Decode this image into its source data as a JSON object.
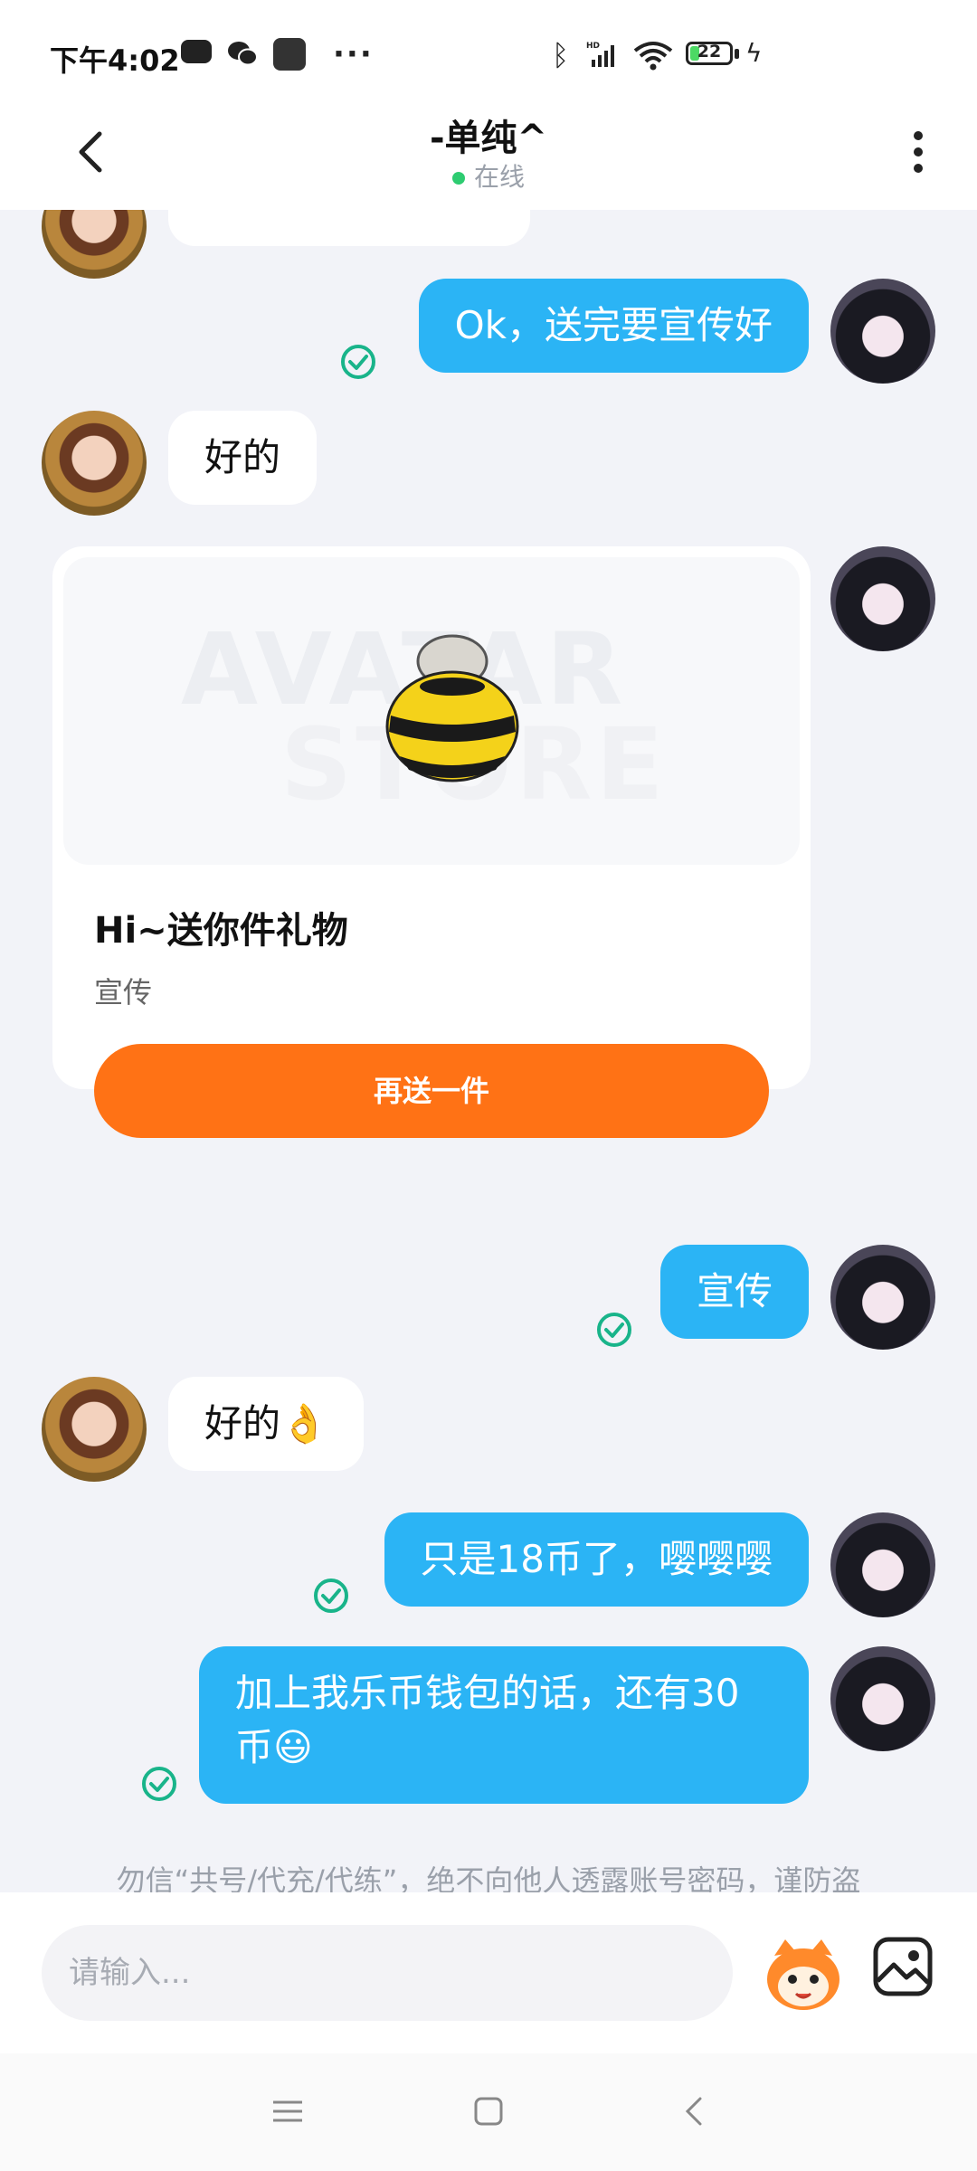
{
  "status_bar": {
    "time": "下午4:02",
    "battery_level": "22",
    "icons": [
      "game-icon",
      "wechat-icon",
      "app-icon",
      "more-dots-icon",
      "bluetooth-icon",
      "signal-icon",
      "wifi-icon",
      "battery-icon",
      "charging-icon"
    ]
  },
  "header": {
    "title": "-单纯^",
    "status": "在线",
    "status_color": "#2ecc71"
  },
  "messages": [
    {
      "from": "me",
      "text": "Ok，送完要宣传好",
      "read": true
    },
    {
      "from": "her",
      "text": "好的"
    },
    {
      "from": "her",
      "type": "gift_card",
      "title": "Hi~送你件礼物",
      "subtitle": "宣传",
      "button": "再送一件"
    },
    {
      "from": "me",
      "text": "宣传",
      "read": true
    },
    {
      "from": "her",
      "text": "好的👌"
    },
    {
      "from": "me",
      "text": "只是18币了，嘤嘤嘤",
      "read": true
    },
    {
      "from": "me",
      "text": "加上我乐币钱包的话，还有30币😃",
      "read": true
    }
  ],
  "gift_card": {
    "image_watermark_line1": "AVATAR",
    "image_watermark_line2": "STORE",
    "title": "Hi~送你件礼物",
    "subtitle": "宣传",
    "button_label": "再送一件"
  },
  "notice": "勿信“共号/代充/代练”，绝不向他人透露账号密码，谨防盗",
  "input": {
    "placeholder": "请输入..."
  },
  "colors": {
    "outgoing_bubble": "#2bb4f5",
    "incoming_bubble": "#ffffff",
    "gift_button": "#ff7215",
    "read_check": "#19b48a"
  }
}
